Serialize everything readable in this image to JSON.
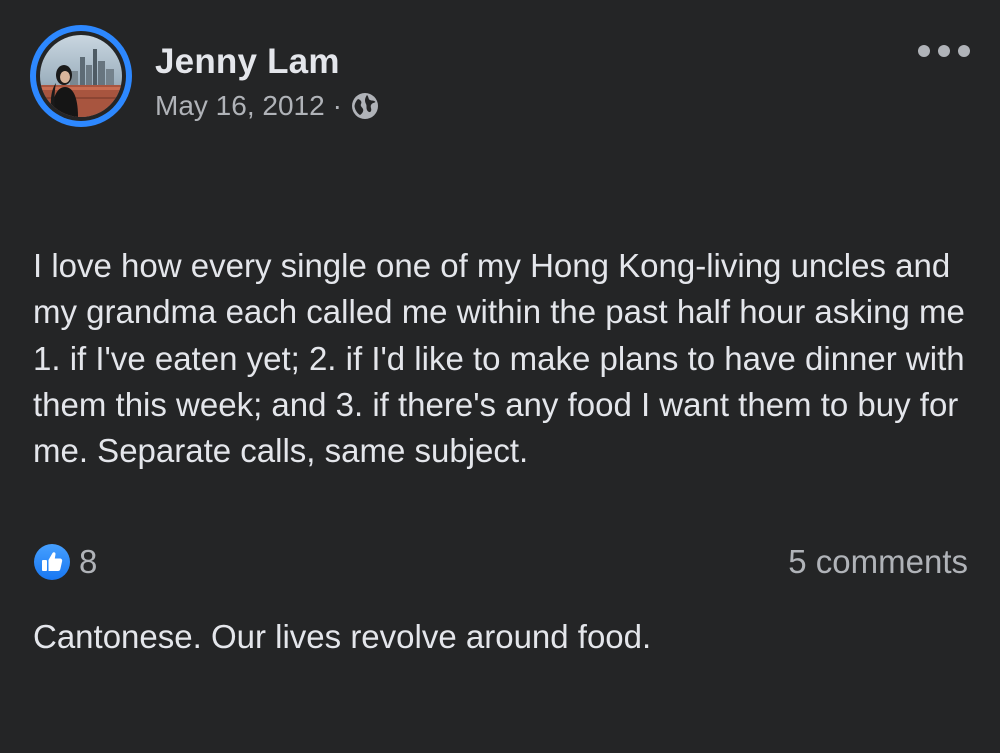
{
  "post": {
    "author": "Jenny Lam",
    "date": "May 16, 2012",
    "separator": "·",
    "privacy_icon": "globe-icon",
    "more_icon": "more-options-icon",
    "text_paragraphs": [
      "I love how every single one of my Hong Kong-living uncles and my grandma each called me within the past half hour asking me 1. if I've eaten yet; 2. if I'd like to make plans to have dinner with them this week; and 3. if there's any food I want them to buy for me. Separate calls, same subject.",
      "Cantonese. Our lives revolve around food."
    ],
    "reaction_icon": "like-icon",
    "reaction_count": "8",
    "comments_label": "5 comments"
  },
  "colors": {
    "background": "#242526",
    "primary_text": "#e4e6eb",
    "secondary_text": "#b0b3b8",
    "accent_blue": "#2d88ff"
  }
}
